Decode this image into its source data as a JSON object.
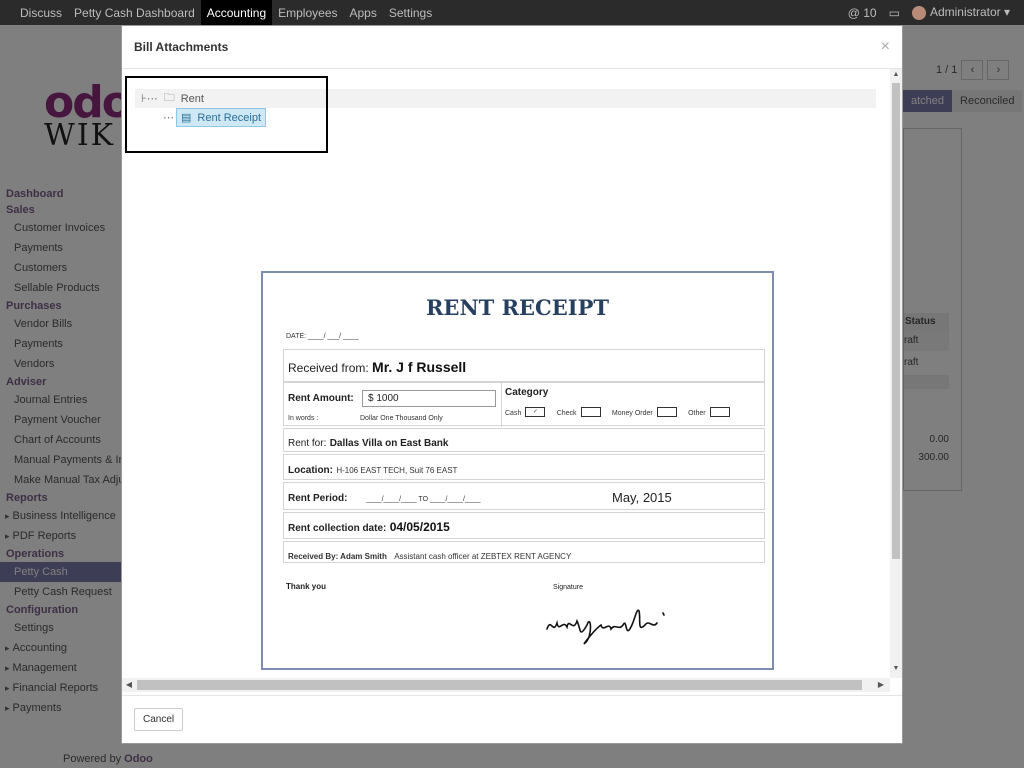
{
  "topbar": {
    "menu": [
      "Discuss",
      "Petty Cash Dashboard",
      "Accounting",
      "Employees",
      "Apps",
      "Settings"
    ],
    "active_index": 2,
    "notifications": "@ 10",
    "user": "Administrator ▾"
  },
  "logo": {
    "line1": "odo",
    "line2": "WIK"
  },
  "sidebar": {
    "dashboard": "Dashboard",
    "sales_hdr": "Sales",
    "sales": [
      "Customer Invoices",
      "Payments",
      "Customers",
      "Sellable Products"
    ],
    "purchases_hdr": "Purchases",
    "purchases": [
      "Vendor Bills",
      "Payments",
      "Vendors"
    ],
    "adviser_hdr": "Adviser",
    "adviser": [
      "Journal Entries",
      "Payment Voucher",
      "Chart of Accounts",
      "Manual Payments & Inv",
      "Make Manual Tax Adjus"
    ],
    "reports_hdr": "Reports",
    "reports": [
      "Business Intelligence",
      "PDF Reports"
    ],
    "operations_hdr": "Operations",
    "operations": [
      "Petty Cash",
      "Petty Cash Request"
    ],
    "configuration_hdr": "Configuration",
    "configuration": [
      "Settings",
      "Accounting",
      "Management",
      "Financial Reports",
      "Payments"
    ],
    "powered_prefix": "Powered by",
    "powered_brand": "Odoo"
  },
  "background": {
    "pager": "1 / 1",
    "status_on": "atched",
    "status_off": "Reconciled",
    "table_hdr": "Status",
    "rows": [
      "raft",
      "raft"
    ],
    "totals": [
      "0.00",
      "300.00"
    ]
  },
  "modal": {
    "title": "Bill Attachments",
    "close": "×",
    "cancel": "Cancel",
    "tree": {
      "root": "Rent",
      "child": "Rent Receipt"
    }
  },
  "receipt": {
    "title": "RENT RECEIPT",
    "date": "DATE: ____/ ___/ ____",
    "received_from_label": "Received from:",
    "received_from": "Mr. J f Russell",
    "rent_amount_label": "Rent Amount:",
    "rent_amount": "$ 1000",
    "in_words_label": "In words :",
    "in_words": "Dollar  One Thousand  Only",
    "category_label": "Category",
    "categories": [
      "Cash",
      "Check",
      "Money Order",
      "Other"
    ],
    "rent_for_label": "Rent for:",
    "rent_for": "Dallas Villa on East Bank",
    "location_label": "Location:",
    "location": "H-106 EAST TECH, Suit 76 EAST",
    "rent_period_label": "Rent Period:",
    "rent_period_blank": "____/____/____   TO  ____/____/____",
    "rent_period_value": "May, 2015",
    "collection_label": "Rent collection date:",
    "collection_date": "04/05/2015",
    "received_by_label": "Received By: Adam Smith",
    "received_by_role": "Assistant cash officer at ZEBTEX  RENT AGENCY",
    "thank_you": "Thank you",
    "signature_label": "Signature"
  }
}
